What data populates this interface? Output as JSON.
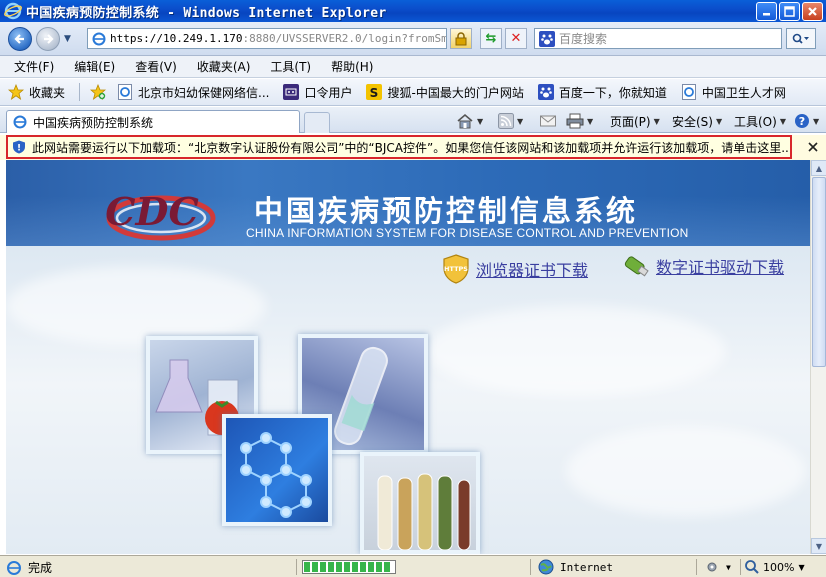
{
  "window": {
    "title": "中国疾病预防控制系统 - Windows Internet Explorer"
  },
  "address": {
    "url_host": "https://10.249.1.170",
    "url_rest": ":8880/UVSSERVER2.0/login?fromSmp=t",
    "search_placeholder": "百度搜索"
  },
  "menu": [
    "文件(F)",
    "编辑(E)",
    "查看(V)",
    "收藏夹(A)",
    "工具(T)",
    "帮助(H)"
  ],
  "favorites": {
    "label": "收藏夹",
    "items": [
      {
        "label": "北京市妇幼保健网络信...",
        "icon": "ie-page-icon"
      },
      {
        "label": "口令用户",
        "icon": "key-icon"
      },
      {
        "label": "搜狐-中国最大的门户网站",
        "icon": "sohu-icon"
      },
      {
        "label": "百度一下，你就知道",
        "icon": "baidu-paw-icon"
      },
      {
        "label": "中国卫生人才网",
        "icon": "ie-page-icon"
      }
    ]
  },
  "tab": {
    "label": "中国疾病预防控制系统"
  },
  "commands": {
    "page": "页面(P)",
    "safety": "安全(S)",
    "tools": "工具(O)"
  },
  "infobar": {
    "message": "此网站需要运行以下加载项：“北京数字认证股份有限公司”中的“BJCA控件”。如果您信任该网站和该加载项并允许运行该加载项，请单击这里..."
  },
  "page": {
    "title_cn": "中国疾病预防控制信息系统",
    "title_en": "CHINA INFORMATION SYSTEM FOR DISEASE CONTROL AND PREVENTION",
    "logo_text": "CDC",
    "links": {
      "browser_cert": "浏览器证书下载",
      "cert_driver": "数字证书驱动下载",
      "https_badge": "HTTPS"
    }
  },
  "status": {
    "text": "完成",
    "zone": "Internet",
    "zoom": "100%",
    "progress_blocks": 11
  },
  "colors": {
    "titlebar": "#0b4ecb",
    "infobar_border": "#d8262b",
    "banner": "#2d6bb8",
    "link": "#3a3fa0"
  }
}
